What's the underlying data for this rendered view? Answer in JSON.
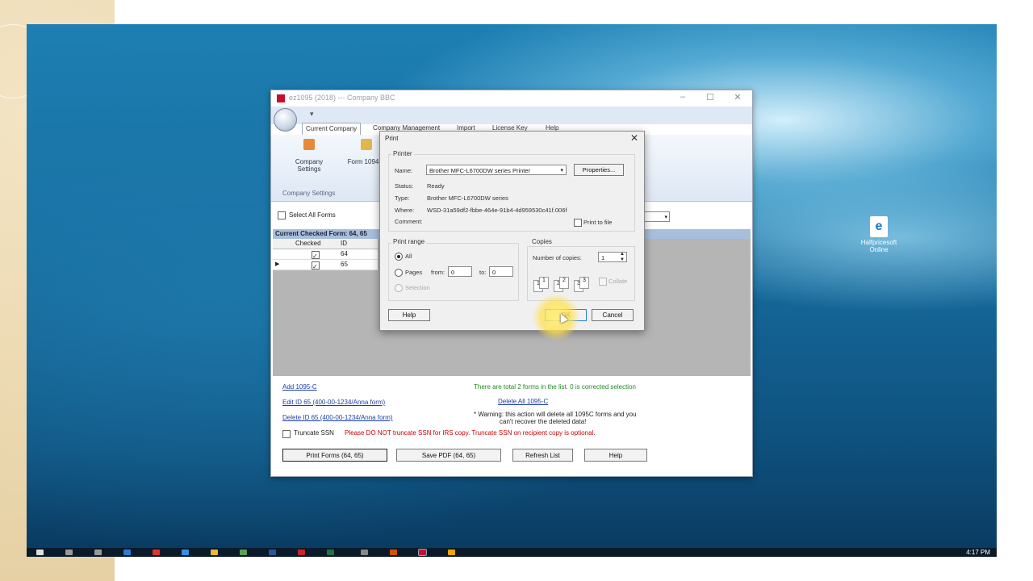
{
  "desktop": {
    "icon_label": "Halfpricesoft Online",
    "icon_glyph": "e",
    "clock": "4:17 PM"
  },
  "app": {
    "title": "ez1095 (2018) --- Company BBC",
    "tabs": [
      "Current Company",
      "Company Management",
      "Import",
      "License Key",
      "Help"
    ],
    "ribbon_buttons": [
      {
        "label": "Company Settings"
      },
      {
        "label": "Form 1094-B"
      }
    ],
    "group_label": "Company Settings",
    "select_all_label": "Select All Forms",
    "grid_header": "Current Checked Form: 64, 65",
    "columns": [
      "Checked",
      "ID"
    ],
    "rows": [
      {
        "id": "64"
      },
      {
        "id": "65"
      }
    ],
    "links": {
      "add": "Add 1095-C",
      "edit": "Edit ID 65 (400-00-1234/Anna form)",
      "delete": "Delete ID 65 (400-00-1234/Anna form)",
      "delete_all": "Delete All 1095-C"
    },
    "status_text": "There are total 2 forms in the list. 0 is corrected selection",
    "warning_line1": "* Warning: this action will delete all 1095C forms and you",
    "warning_line2": "can't recover the deleted data!",
    "truncate_label": "Truncate SSN",
    "truncate_note": "Please DO NOT truncate SSN for IRS copy. Truncate SSN on recipient copy is optional.",
    "buttons": {
      "print": "Print Forms (64, 65)",
      "save_pdf": "Save PDF (64, 65)",
      "refresh": "Refresh List",
      "help": "Help"
    }
  },
  "print_dialog": {
    "title": "Print",
    "printer_group": "Printer",
    "name_label": "Name:",
    "name_value": "Brother MFC-L6700DW series Printer",
    "properties": "Properties...",
    "status_label": "Status:",
    "status_value": "Ready",
    "type_label": "Type:",
    "type_value": "Brother MFC-L6700DW series",
    "where_label": "Where:",
    "where_value": "WSD-31a59df2-fbbe-464e-91b4-4d959530c41f.006f",
    "comment_label": "Comment:",
    "print_to_file": "Print to file",
    "range_group": "Print range",
    "all": "All",
    "pages": "Pages",
    "from_label": "from:",
    "from_value": "0",
    "to_label": "to:",
    "to_value": "0",
    "selection": "Selection",
    "copies_group": "Copies",
    "num_copies_label": "Number of copies:",
    "num_copies_value": "1",
    "collate": "Collate",
    "collate_pages": [
      "1",
      "1",
      "2",
      "2",
      "3",
      "3"
    ],
    "help": "Help",
    "ok": "OK",
    "cancel": "Cancel"
  }
}
